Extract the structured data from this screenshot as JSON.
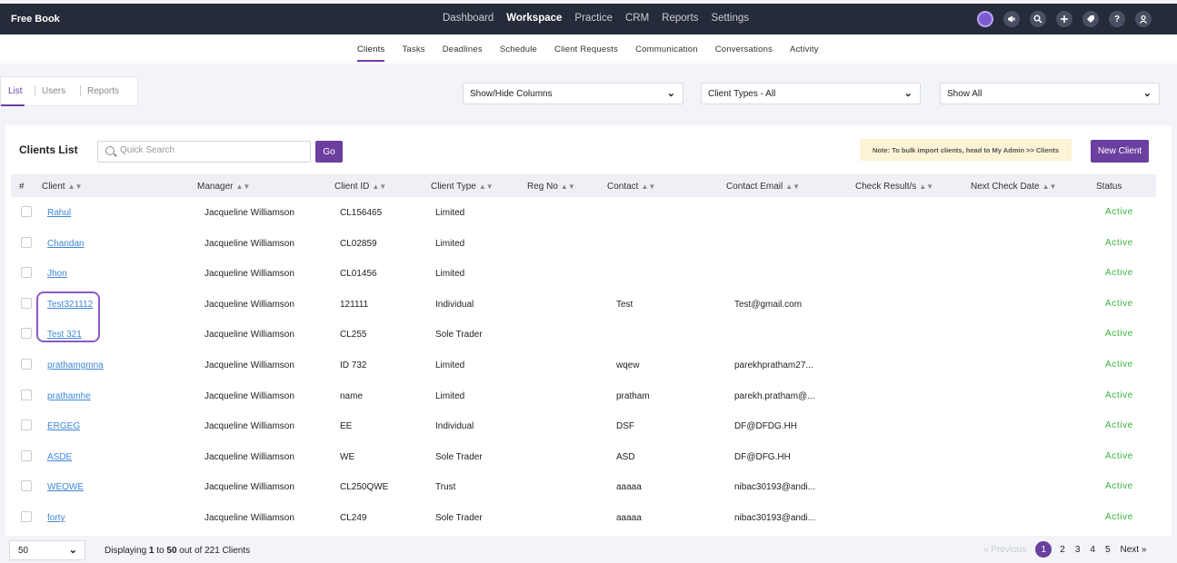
{
  "app": {
    "title": "Free Book"
  },
  "nav": {
    "items": [
      "Dashboard",
      "Workspace",
      "Practice",
      "CRM",
      "Reports",
      "Settings"
    ],
    "active": "Workspace",
    "icons": [
      "profile-icon",
      "megaphone-icon",
      "search-icon",
      "plus-icon",
      "tag-icon",
      "help-icon",
      "user-icon"
    ]
  },
  "subnav": {
    "items": [
      "Clients",
      "Tasks",
      "Deadlines",
      "Schedule",
      "Client Requests",
      "Communication",
      "Conversations",
      "Activity"
    ],
    "active": "Clients"
  },
  "leftTabs": [
    "List",
    "Users",
    "Reports"
  ],
  "filters": {
    "columns": "Show/Hide Columns",
    "clientTypes": "Client Types - All",
    "show": "Show All"
  },
  "card": {
    "title": "Clients List",
    "searchPlaceholder": "Quick Search",
    "goLabel": "Go",
    "note": "Note:  To bulk import clients, head to My Admin >> Clients",
    "newClient": "New Client"
  },
  "table": {
    "headers": [
      "#",
      "Client",
      "Manager",
      "Client ID",
      "Client Type",
      "Reg No",
      "Contact",
      "Contact Email",
      "Check Result/s",
      "Next Check Date",
      "Status"
    ],
    "rows": [
      {
        "client": "Rahul",
        "manager": "Jacqueline Williamson",
        "id": "CL156465",
        "type": "Limited",
        "contact": "",
        "email": "",
        "status": "Active"
      },
      {
        "client": "Chandan",
        "manager": "Jacqueline Williamson",
        "id": "CL02859",
        "type": "Limited",
        "contact": "",
        "email": "",
        "status": "Active"
      },
      {
        "client": "Jhon",
        "manager": "Jacqueline Williamson",
        "id": "CL01456",
        "type": "Limited",
        "contact": "",
        "email": "",
        "status": "Active"
      },
      {
        "client": "Test321112",
        "manager": "Jacqueline Williamson",
        "id": "121111",
        "type": "Individual",
        "contact": "Test",
        "email": "Test@gmail.com",
        "status": "Active"
      },
      {
        "client": "Test 321",
        "manager": "Jacqueline Williamson",
        "id": "CL255",
        "type": "Sole Trader",
        "contact": "",
        "email": "",
        "status": "Active"
      },
      {
        "client": "prathamgmna",
        "manager": "Jacqueline Williamson",
        "id": "ID 732",
        "type": "Limited",
        "contact": "wqew",
        "email": "parekhpratham27...",
        "status": "Active"
      },
      {
        "client": "prathamhe",
        "manager": "Jacqueline Williamson",
        "id": "name",
        "type": "Limited",
        "contact": "pratham",
        "email": "parekh.pratham@...",
        "status": "Active"
      },
      {
        "client": "ERGEG",
        "manager": "Jacqueline Williamson",
        "id": "EE",
        "type": "Individual",
        "contact": "DSF",
        "email": "DF@DFDG.HH",
        "status": "Active"
      },
      {
        "client": "ASDE",
        "manager": "Jacqueline Williamson",
        "id": "WE",
        "type": "Sole Trader",
        "contact": "ASD",
        "email": "DF@DFG.HH",
        "status": "Active"
      },
      {
        "client": "WEQWE",
        "manager": "Jacqueline Williamson",
        "id": "CL250QWE",
        "type": "Trust",
        "contact": "aaaaa",
        "email": "nibac30193@andi...",
        "status": "Active"
      },
      {
        "client": "forty",
        "manager": "Jacqueline Williamson",
        "id": "CL249",
        "type": "Sole Trader",
        "contact": "aaaaa",
        "email": "nibac30193@andi...",
        "status": "Active"
      }
    ]
  },
  "footer": {
    "pageSize": "50",
    "display": {
      "prefix": "Displaying ",
      "from": "1",
      "to": " to ",
      "count": "50",
      "suffix": " out of 221 Clients"
    },
    "pagination": {
      "prev": "« Previous",
      "pages": [
        "1",
        "2",
        "3",
        "4",
        "5"
      ],
      "current": "1",
      "next": "Next »"
    }
  },
  "colors": {
    "accent": "#6b3fa0",
    "topbar": "#262b3a",
    "active": "#36b23a",
    "link": "#3f86d8",
    "note": "#fdf3d6"
  }
}
